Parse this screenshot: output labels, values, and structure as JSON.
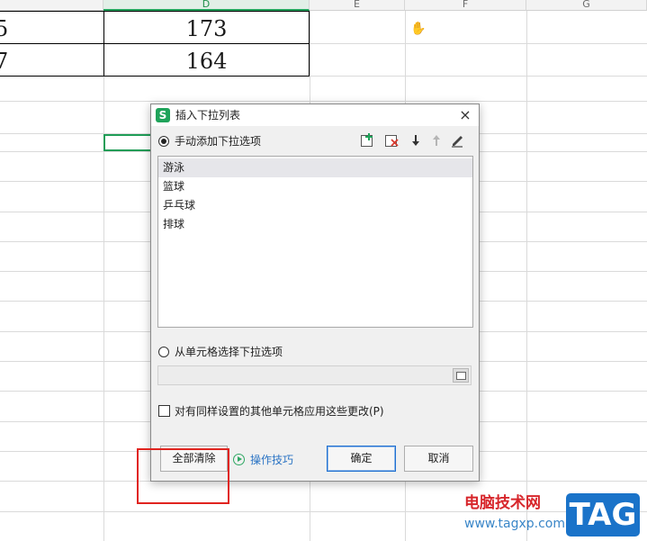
{
  "sheet": {
    "columns": [
      {
        "label": "D",
        "active": true
      },
      {
        "label": "E",
        "active": false
      },
      {
        "label": "F",
        "active": false
      },
      {
        "label": "G",
        "active": false
      }
    ],
    "rows": [
      {
        "left_value": "5",
        "right_value": "173"
      },
      {
        "left_value": "7",
        "right_value": "164"
      }
    ]
  },
  "dialog": {
    "title": "插入下拉列表",
    "app_icon": "S",
    "close_symbol": "×",
    "manual_option_label": "手动添加下拉选项",
    "manual_option_checked": true,
    "items": [
      "游泳",
      "篮球",
      "乒乓球",
      "排球"
    ],
    "selected_item_index": 0,
    "cell_option_label": "从单元格选择下拉选项",
    "cell_option_checked": false,
    "apply_checkbox_label": "对有同样设置的其他单元格应用这些更改(P)",
    "apply_checkbox_checked": false,
    "clear_all_label": "全部清除",
    "tips_label": "操作技巧",
    "ok_label": "确定",
    "cancel_label": "取消",
    "toolbar_icons": [
      "add-icon",
      "delete-icon",
      "move-down-icon",
      "move-up-icon",
      "edit-icon"
    ]
  },
  "watermark": {
    "site_name": "电脑技术网",
    "url": "www.tagxp.com",
    "tag": "TAG"
  },
  "colors": {
    "accent_green": "#1fa35a",
    "highlight_red": "#e0241f",
    "link_blue": "#2a73c4",
    "tag_blue": "#1a73c9"
  }
}
